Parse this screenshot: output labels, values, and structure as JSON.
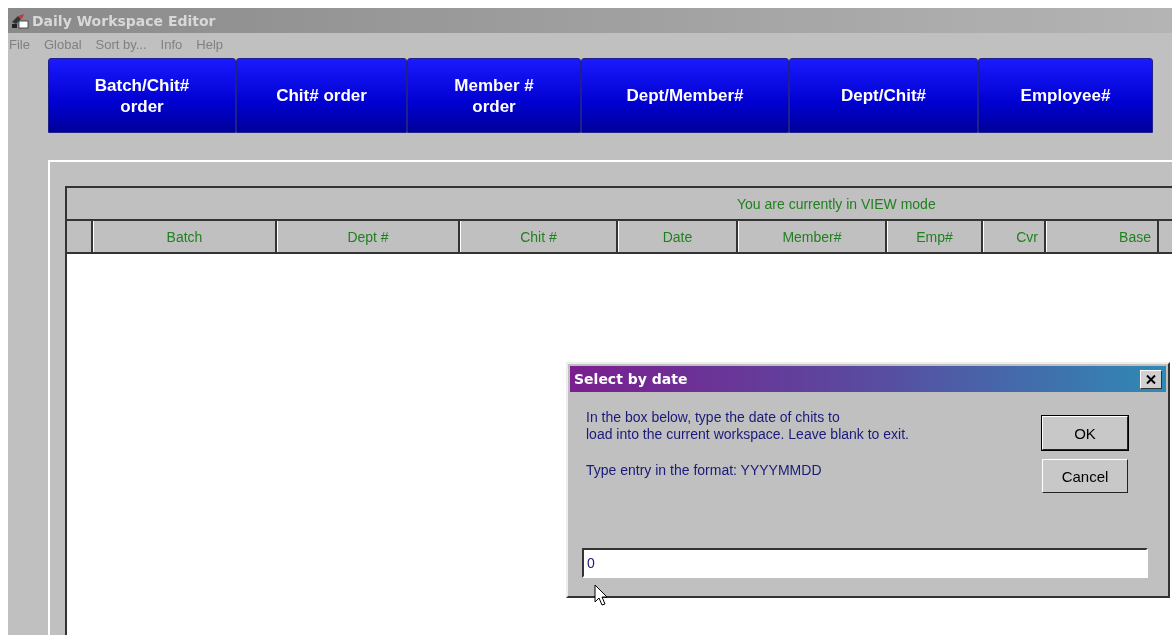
{
  "window": {
    "title": "Daily Workspace Editor"
  },
  "menu": [
    "File",
    "Global",
    "Sort by...",
    "Info",
    "Help"
  ],
  "sort_buttons": [
    {
      "label": "Batch/Chit#\norder"
    },
    {
      "label": "Chit# order"
    },
    {
      "label": "Member #\norder"
    },
    {
      "label": "Dept/Member#"
    },
    {
      "label": "Dept/Chit#"
    },
    {
      "label": "Employee#"
    }
  ],
  "grid": {
    "mode_message": "You are currently in VIEW mode",
    "columns": [
      "Batch",
      "Dept #",
      "Chit #",
      "Date",
      "Member#",
      "Emp#",
      "Cvr",
      "Base"
    ]
  },
  "dialog": {
    "title": "Select by date",
    "message": "In the box below, type the date of chits to\nload into the current workspace. Leave blank to exit.",
    "format_hint": "Type entry in the format: YYYYMMDD",
    "buttons": [
      {
        "label": "OK",
        "default": true
      },
      {
        "label": "Cancel",
        "default": false
      }
    ],
    "input": {
      "value": "0"
    }
  }
}
